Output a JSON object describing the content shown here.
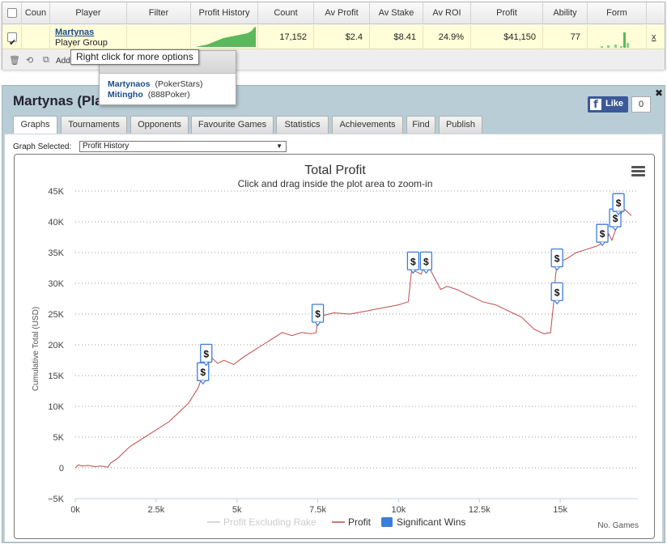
{
  "grid": {
    "headers": {
      "count_short": "Coun",
      "player": "Player",
      "filter": "Filter",
      "profit_history": "Profit History",
      "count": "Count",
      "av_profit": "Av Profit",
      "av_stake": "Av Stake",
      "av_roi": "Av ROI",
      "profit": "Profit",
      "ability": "Ability",
      "form": "Form"
    },
    "row": {
      "player_name": "Martynas",
      "player_type": "Player Group",
      "count": "17,152",
      "av_profit": "$2.4",
      "av_stake": "$8.41",
      "av_roi": "24.9%",
      "profit": "$41,150",
      "ability": "77",
      "remove": "x"
    },
    "toolbar": {
      "add_label": "Add"
    }
  },
  "tooltip": "Right click for more options",
  "group_popup": {
    "members": [
      {
        "name": "Martynaos",
        "network": "(PokerStars)"
      },
      {
        "name": "Mitingho",
        "network": "(888Poker)"
      }
    ]
  },
  "panel": {
    "title": "Martynas (Pla",
    "fb_like": "Like",
    "fb_count": "0",
    "close": "✖",
    "tabs": [
      "Graphs",
      "Tournaments",
      "Opponents",
      "Favourite Games",
      "Statistics",
      "Achievements",
      "Find",
      "Publish"
    ],
    "graph_selected_label": "Graph Selected:",
    "graph_selected_value": "Profit History"
  },
  "chart_data": {
    "type": "line",
    "title": "Total Profit",
    "subtitle": "Click and drag inside the plot area to zoom-in",
    "xlabel": "No. Games",
    "ylabel": "Cumulative Total (USD)",
    "xlim": [
      0,
      17400
    ],
    "ylim": [
      -5000,
      45000
    ],
    "x_ticks": [
      "0k",
      "2.5k",
      "5k",
      "7.5k",
      "10k",
      "12.5k",
      "15k"
    ],
    "x_tick_values": [
      0,
      2500,
      5000,
      7500,
      10000,
      12500,
      15000
    ],
    "y_ticks": [
      "−5K",
      "0",
      "5K",
      "10K",
      "15K",
      "20K",
      "25K",
      "30K",
      "35K",
      "40K",
      "45K"
    ],
    "y_tick_values": [
      -5000,
      0,
      5000,
      10000,
      15000,
      20000,
      25000,
      30000,
      35000,
      40000,
      45000
    ],
    "grid": true,
    "legend_position": "bottom",
    "series": [
      {
        "name": "Profit Excluding Rake",
        "color": "#cccccc",
        "visible": false,
        "values": []
      },
      {
        "name": "Profit",
        "color": "#c04a4a",
        "x": [
          0,
          100,
          200,
          400,
          600,
          800,
          1000,
          1100,
          1300,
          1500,
          1700,
          2000,
          2300,
          2600,
          2900,
          3200,
          3500,
          3800,
          3900,
          4000,
          4050,
          4100,
          4200,
          4400,
          4600,
          4900,
          5200,
          5500,
          5800,
          6100,
          6400,
          6700,
          7000,
          7300,
          7450,
          7500,
          7550,
          7700,
          8000,
          8500,
          9000,
          9500,
          10000,
          10300,
          10400,
          10450,
          10500,
          10700,
          10800,
          10850,
          10900,
          11100,
          11300,
          11500,
          11800,
          12200,
          12600,
          13000,
          13400,
          13800,
          14200,
          14500,
          14700,
          14800,
          14850,
          14900,
          15000,
          15200,
          15500,
          15800,
          16100,
          16300,
          16450,
          16500,
          16600,
          16700,
          16800,
          16900,
          17000,
          17100,
          17200
        ],
        "values": [
          0,
          500,
          300,
          400,
          200,
          300,
          100,
          800,
          1500,
          2500,
          3500,
          4500,
          5500,
          6500,
          7500,
          9000,
          10500,
          13000,
          14500,
          16000,
          17000,
          18500,
          18000,
          17000,
          17500,
          16800,
          18000,
          19000,
          20000,
          21000,
          22000,
          21500,
          22000,
          21800,
          22000,
          24500,
          25000,
          24800,
          25200,
          25000,
          25500,
          26000,
          26500,
          27000,
          32000,
          33000,
          32000,
          31500,
          32800,
          33500,
          33000,
          31000,
          29000,
          29500,
          29000,
          28000,
          27000,
          26500,
          25500,
          24500,
          22500,
          21800,
          22000,
          27000,
          31000,
          33000,
          33500,
          34000,
          35000,
          35500,
          36000,
          36500,
          37000,
          38000,
          37000,
          38500,
          40000,
          41500,
          42000,
          41500,
          41000
        ]
      }
    ],
    "significant_wins_label": "Significant Wins",
    "significant_wins": [
      {
        "x": 3950,
        "y": 15500
      },
      {
        "x": 4050,
        "y": 18500
      },
      {
        "x": 7500,
        "y": 25000
      },
      {
        "x": 10450,
        "y": 33500
      },
      {
        "x": 10850,
        "y": 33500
      },
      {
        "x": 14900,
        "y": 28500
      },
      {
        "x": 14900,
        "y": 34000
      },
      {
        "x": 16300,
        "y": 38000
      },
      {
        "x": 16700,
        "y": 40500
      },
      {
        "x": 16800,
        "y": 43000
      }
    ]
  }
}
